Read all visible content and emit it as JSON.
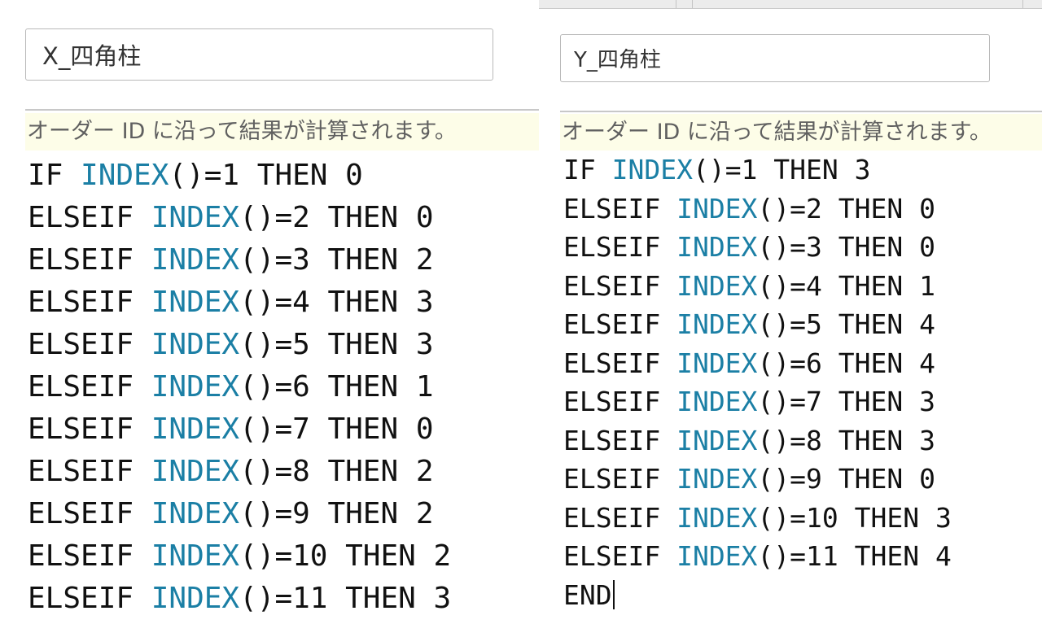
{
  "left": {
    "name_field": {
      "value": "X_四角柱"
    },
    "status_text": "オーダー ID に沿って結果が計算されます。",
    "code_lines": [
      {
        "head": "IF ",
        "fn": "INDEX",
        "tail": "()=1 THEN 0"
      },
      {
        "head": "ELSEIF ",
        "fn": "INDEX",
        "tail": "()=2 THEN 0"
      },
      {
        "head": "ELSEIF ",
        "fn": "INDEX",
        "tail": "()=3 THEN 2"
      },
      {
        "head": "ELSEIF ",
        "fn": "INDEX",
        "tail": "()=4 THEN 3"
      },
      {
        "head": "ELSEIF ",
        "fn": "INDEX",
        "tail": "()=5 THEN 3"
      },
      {
        "head": "ELSEIF ",
        "fn": "INDEX",
        "tail": "()=6 THEN 1"
      },
      {
        "head": "ELSEIF ",
        "fn": "INDEX",
        "tail": "()=7 THEN 0"
      },
      {
        "head": "ELSEIF ",
        "fn": "INDEX",
        "tail": "()=8 THEN 2"
      },
      {
        "head": "ELSEIF ",
        "fn": "INDEX",
        "tail": "()=9 THEN 2"
      },
      {
        "head": "ELSEIF ",
        "fn": "INDEX",
        "tail": "()=10 THEN 2"
      },
      {
        "head": "ELSEIF ",
        "fn": "INDEX",
        "tail": "()=11 THEN 3"
      }
    ]
  },
  "right": {
    "name_field": {
      "value": "Y_四角柱"
    },
    "status_text": "オーダー ID に沿って結果が計算されます。",
    "code_lines": [
      {
        "head": "IF ",
        "fn": "INDEX",
        "tail": "()=1 THEN 3"
      },
      {
        "head": "ELSEIF ",
        "fn": "INDEX",
        "tail": "()=2 THEN 0"
      },
      {
        "head": "ELSEIF ",
        "fn": "INDEX",
        "tail": "()=3 THEN 0"
      },
      {
        "head": "ELSEIF ",
        "fn": "INDEX",
        "tail": "()=4 THEN 1"
      },
      {
        "head": "ELSEIF ",
        "fn": "INDEX",
        "tail": "()=5 THEN 4"
      },
      {
        "head": "ELSEIF ",
        "fn": "INDEX",
        "tail": "()=6 THEN 4"
      },
      {
        "head": "ELSEIF ",
        "fn": "INDEX",
        "tail": "()=7 THEN 3"
      },
      {
        "head": "ELSEIF ",
        "fn": "INDEX",
        "tail": "()=8 THEN 3"
      },
      {
        "head": "ELSEIF ",
        "fn": "INDEX",
        "tail": "()=9 THEN 0"
      },
      {
        "head": "ELSEIF ",
        "fn": "INDEX",
        "tail": "()=10 THEN 3"
      },
      {
        "head": "ELSEIF ",
        "fn": "INDEX",
        "tail": "()=11 THEN 4"
      },
      {
        "head": "END",
        "fn": "",
        "tail": ""
      }
    ],
    "caret_after_last_line": true
  },
  "colors": {
    "function_keyword": "#1b7fa5",
    "code_text": "#111111",
    "status_background": "#fdfde8",
    "status_text": "#606060",
    "field_border": "#b9b9b9"
  }
}
